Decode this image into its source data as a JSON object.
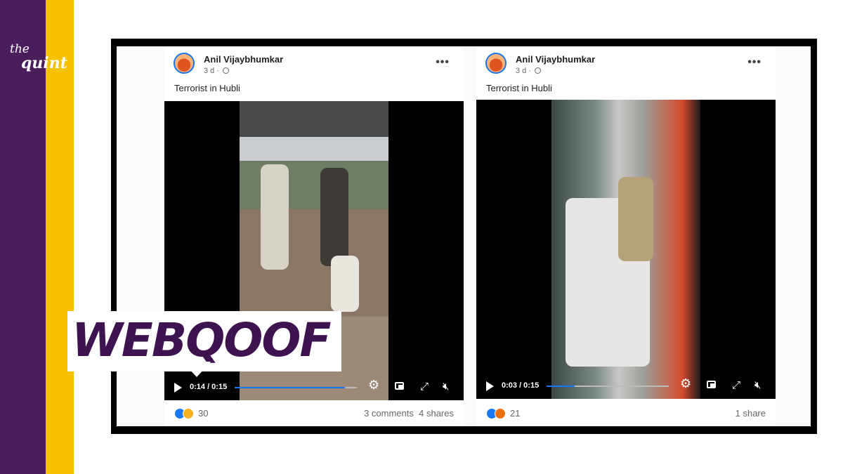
{
  "brand": {
    "logo_line1": "the",
    "logo_line2": "quint",
    "purple": "#4a1d5c",
    "yellow": "#f6c200"
  },
  "banner": {
    "text": "WEBQOOF",
    "color": "#3d1450"
  },
  "posts": [
    {
      "author": "Anil Vijaybhumkar",
      "time": "3 d ·",
      "caption": "Terrorist in Hubli",
      "video": {
        "time": "0:14 / 0:15",
        "progress": 0.9
      },
      "reactions": [
        "like-icon",
        "wow-icon"
      ],
      "reaction_count": "30",
      "comments": "3 comments",
      "shares": "4 shares"
    },
    {
      "author": "Anil Vijaybhumkar",
      "time": "3 d ·",
      "caption": "Terrorist in Hubli",
      "video": {
        "time": "0:03 / 0:15",
        "progress": 0.23
      },
      "reactions": [
        "like-icon",
        "angry-icon"
      ],
      "reaction_count": "21",
      "comments": "",
      "shares": "1 share"
    }
  ]
}
